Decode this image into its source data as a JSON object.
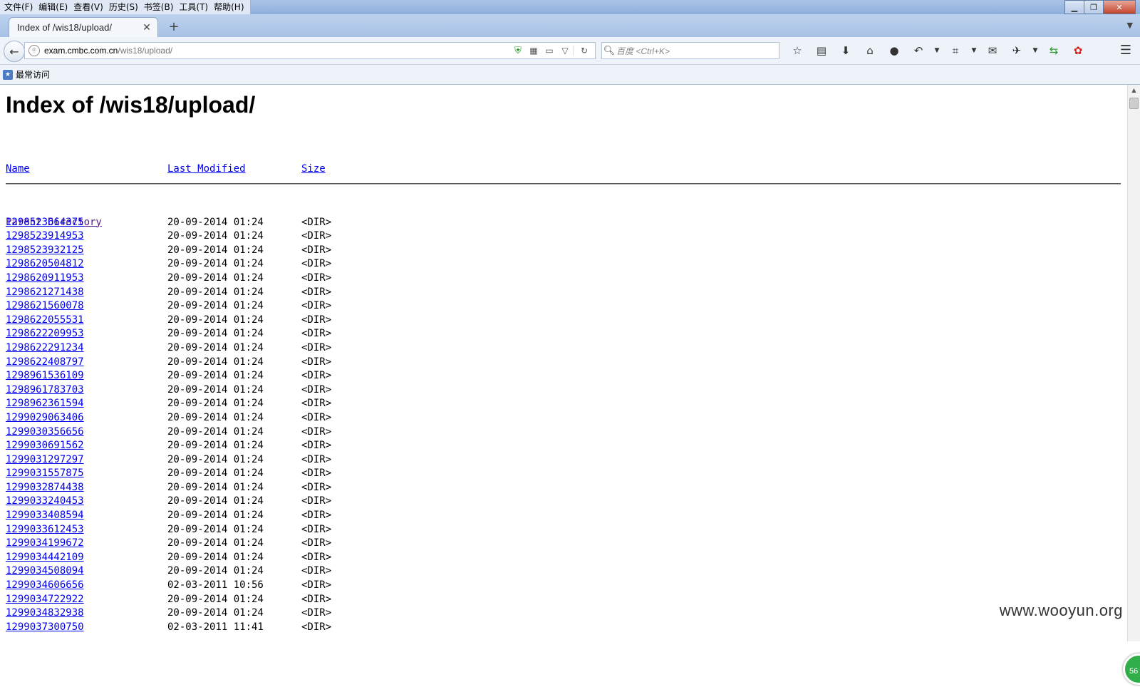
{
  "menubar": {
    "items": [
      "文件(F)",
      "编辑(E)",
      "查看(V)",
      "历史(S)",
      "书签(B)",
      "工具(T)",
      "帮助(H)"
    ]
  },
  "tab": {
    "title": "Index of /wis18/upload/"
  },
  "navbar": {
    "url_host": "exam.cmbc.com.cn",
    "url_path": "/wis18/upload/",
    "search_placeholder": "百度 <Ctrl+K>"
  },
  "bookmarks": {
    "most_visited": "最常访问"
  },
  "page": {
    "title": "Index of /wis18/upload/",
    "columns": {
      "name": "Name",
      "last_modified": "Last Modified",
      "size": "Size"
    },
    "parent_directory": "Parent Directory",
    "entries": [
      {
        "name": "1298523664375",
        "modified": "20-09-2014 01:24",
        "size": "<DIR>"
      },
      {
        "name": "1298523914953",
        "modified": "20-09-2014 01:24",
        "size": "<DIR>"
      },
      {
        "name": "1298523932125",
        "modified": "20-09-2014 01:24",
        "size": "<DIR>"
      },
      {
        "name": "1298620504812",
        "modified": "20-09-2014 01:24",
        "size": "<DIR>"
      },
      {
        "name": "1298620911953",
        "modified": "20-09-2014 01:24",
        "size": "<DIR>"
      },
      {
        "name": "1298621271438",
        "modified": "20-09-2014 01:24",
        "size": "<DIR>"
      },
      {
        "name": "1298621560078",
        "modified": "20-09-2014 01:24",
        "size": "<DIR>"
      },
      {
        "name": "1298622055531",
        "modified": "20-09-2014 01:24",
        "size": "<DIR>"
      },
      {
        "name": "1298622209953",
        "modified": "20-09-2014 01:24",
        "size": "<DIR>"
      },
      {
        "name": "1298622291234",
        "modified": "20-09-2014 01:24",
        "size": "<DIR>"
      },
      {
        "name": "1298622408797",
        "modified": "20-09-2014 01:24",
        "size": "<DIR>"
      },
      {
        "name": "1298961536109",
        "modified": "20-09-2014 01:24",
        "size": "<DIR>"
      },
      {
        "name": "1298961783703",
        "modified": "20-09-2014 01:24",
        "size": "<DIR>"
      },
      {
        "name": "1298962361594",
        "modified": "20-09-2014 01:24",
        "size": "<DIR>"
      },
      {
        "name": "1299029063406",
        "modified": "20-09-2014 01:24",
        "size": "<DIR>"
      },
      {
        "name": "1299030356656",
        "modified": "20-09-2014 01:24",
        "size": "<DIR>"
      },
      {
        "name": "1299030691562",
        "modified": "20-09-2014 01:24",
        "size": "<DIR>"
      },
      {
        "name": "1299031297297",
        "modified": "20-09-2014 01:24",
        "size": "<DIR>"
      },
      {
        "name": "1299031557875",
        "modified": "20-09-2014 01:24",
        "size": "<DIR>"
      },
      {
        "name": "1299032874438",
        "modified": "20-09-2014 01:24",
        "size": "<DIR>"
      },
      {
        "name": "1299033240453",
        "modified": "20-09-2014 01:24",
        "size": "<DIR>"
      },
      {
        "name": "1299033408594",
        "modified": "20-09-2014 01:24",
        "size": "<DIR>"
      },
      {
        "name": "1299033612453",
        "modified": "20-09-2014 01:24",
        "size": "<DIR>"
      },
      {
        "name": "1299034199672",
        "modified": "20-09-2014 01:24",
        "size": "<DIR>"
      },
      {
        "name": "1299034442109",
        "modified": "20-09-2014 01:24",
        "size": "<DIR>"
      },
      {
        "name": "1299034508094",
        "modified": "20-09-2014 01:24",
        "size": "<DIR>"
      },
      {
        "name": "1299034606656",
        "modified": "02-03-2011 10:56",
        "size": "<DIR>"
      },
      {
        "name": "1299034722922",
        "modified": "20-09-2014 01:24",
        "size": "<DIR>"
      },
      {
        "name": "1299034832938",
        "modified": "20-09-2014 01:24",
        "size": "<DIR>"
      },
      {
        "name": "1299037300750",
        "modified": "02-03-2011 11:41",
        "size": "<DIR>"
      }
    ]
  },
  "overlay": {
    "badge": "56",
    "watermark": "www.wooyun.org"
  }
}
